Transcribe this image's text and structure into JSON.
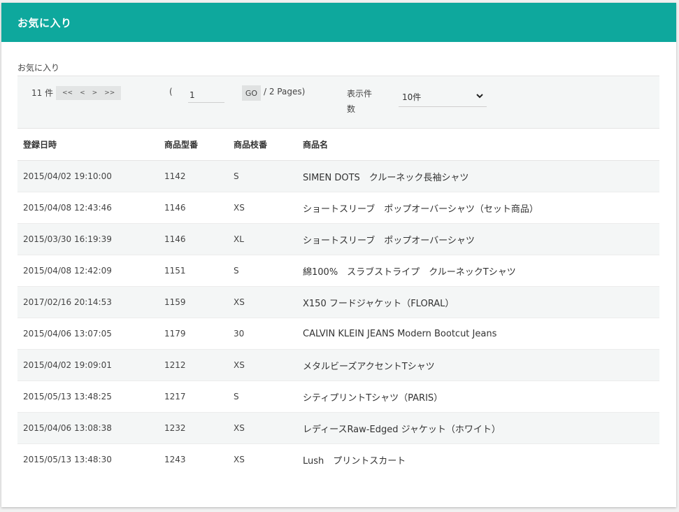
{
  "header": {
    "title": "お気に入り"
  },
  "section_label": "お気に入り",
  "pager": {
    "count": "11 件",
    "nav": {
      "first": "<<",
      "prev": "<",
      "next": ">",
      "last": ">>"
    },
    "paren_open": "(",
    "page_value": "1",
    "go_label": "GO",
    "pages_text": "/ 2 Pages)",
    "display_label": "表示件数",
    "display_value": "10件"
  },
  "table": {
    "headers": [
      "登録日時",
      "商品型番",
      "商品枝番",
      "商品名"
    ],
    "rows": [
      [
        "2015/04/02 19:10:00",
        "1142",
        "S",
        "SIMEN DOTS　クルーネック長袖シャツ"
      ],
      [
        "2015/04/08 12:43:46",
        "1146",
        "XS",
        "ショートスリーブ　ポップオーバーシャツ（セット商品）"
      ],
      [
        "2015/03/30 16:19:39",
        "1146",
        "XL",
        "ショートスリーブ　ポップオーバーシャツ"
      ],
      [
        "2015/04/08 12:42:09",
        "1151",
        "S",
        "綿100%　スラブストライプ　クルーネックTシャツ"
      ],
      [
        "2017/02/16 20:14:53",
        "1159",
        "XS",
        "X150 フードジャケット（FLORAL）"
      ],
      [
        "2015/04/06 13:07:05",
        "1179",
        "30",
        "CALVIN KLEIN JEANS Modern Bootcut Jeans"
      ],
      [
        "2015/04/02 19:09:01",
        "1212",
        "XS",
        "メタルビーズアクセントTシャツ"
      ],
      [
        "2015/05/13 13:48:25",
        "1217",
        "S",
        "シティプリントTシャツ（PARIS）"
      ],
      [
        "2015/04/06 13:08:38",
        "1232",
        "XS",
        "レディースRaw-Edged ジャケット（ホワイト）"
      ],
      [
        "2015/05/13 13:48:30",
        "1243",
        "XS",
        "Lush　プリントスカート"
      ]
    ]
  },
  "colors": {
    "header_bg": "#0ea89d",
    "header_text": "#ffffff",
    "stripe": "#f4f6f6"
  }
}
